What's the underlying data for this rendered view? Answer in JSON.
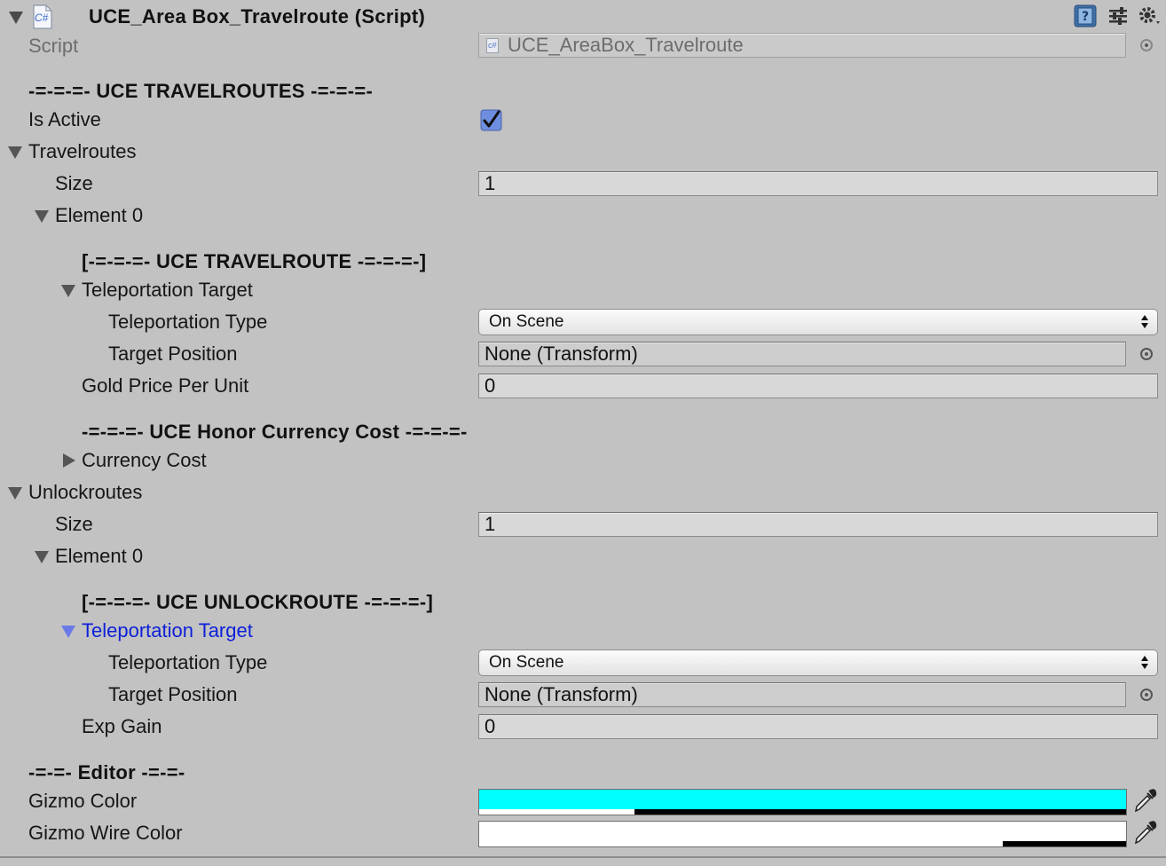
{
  "component": {
    "title": "UCE_Area Box_Travelroute (Script)",
    "script_label": "Script",
    "script_value": "UCE_AreaBox_Travelroute",
    "script_icon_text": "C#",
    "field_icon_text": "c#"
  },
  "section_travelroutes": {
    "header": "-=-=-=- UCE TRAVELROUTES -=-=-=-",
    "is_active_label": "Is Active",
    "is_active": true,
    "list_label": "Travelroutes",
    "size_label": "Size",
    "size_value": "1",
    "element_label": "Element 0",
    "element": {
      "header": "[-=-=-=- UCE TRAVELROUTE -=-=-=-]",
      "teleport_target_label": "Teleportation Target",
      "teleport_type_label": "Teleportation Type",
      "teleport_type_value": "On Scene",
      "target_position_label": "Target Position",
      "target_position_value": "None (Transform)",
      "gold_label": "Gold Price Per Unit",
      "gold_value": "0",
      "honor_header": "-=-=-=- UCE Honor Currency Cost -=-=-=-",
      "currency_cost_label": "Currency Cost"
    }
  },
  "section_unlockroutes": {
    "list_label": "Unlockroutes",
    "size_label": "Size",
    "size_value": "1",
    "element_label": "Element 0",
    "element": {
      "header": "[-=-=-=- UCE UNLOCKROUTE -=-=-=-]",
      "teleport_target_label": "Teleportation Target",
      "teleport_type_label": "Teleportation Type",
      "teleport_type_value": "On Scene",
      "target_position_label": "Target Position",
      "target_position_value": "None (Transform)",
      "exp_label": "Exp Gain",
      "exp_value": "0"
    }
  },
  "section_editor": {
    "header": "-=-=- Editor -=-=-",
    "gizmo_color_label": "Gizmo Color",
    "gizmo_color": "#00ffff",
    "gizmo_color_alpha": 0.24,
    "gizmo_wire_label": "Gizmo Wire Color",
    "gizmo_wire_color": "#ffffff",
    "gizmo_wire_alpha": 0.81
  },
  "colors": {
    "background": "#c2c2c2",
    "selected_text": "#0d20d8",
    "checkbox_fill": "#6e8fe0"
  }
}
